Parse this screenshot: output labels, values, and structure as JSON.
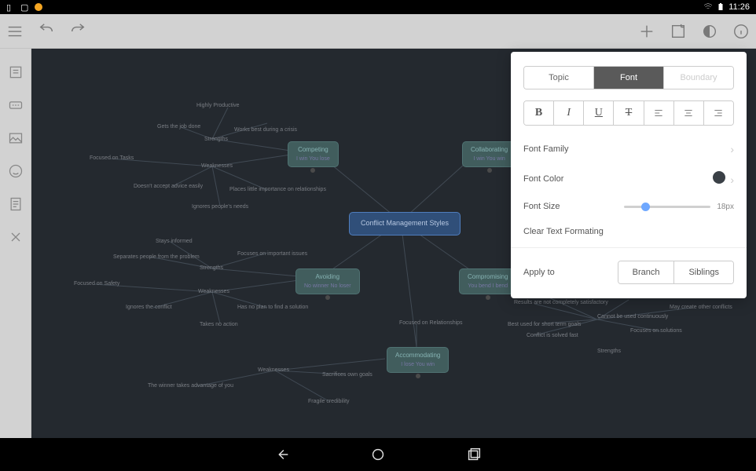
{
  "status": {
    "time": "11:26"
  },
  "toolbar": {
    "menu": "menu",
    "undo": "undo",
    "redo": "redo",
    "add": "add",
    "note": "note",
    "theme": "theme",
    "info": "info"
  },
  "sidebar": {
    "outline": "outline-icon",
    "markers": "markers-icon",
    "image": "image-icon",
    "emoji": "emoji-icon",
    "notes": "notes-icon",
    "collapse": "collapse-icon"
  },
  "mindmap": {
    "center": "Conflict Management Styles",
    "nodes": [
      {
        "id": "competing",
        "title": "Competing",
        "subtitle": "I win You lose"
      },
      {
        "id": "collaborating",
        "title": "Collaborating",
        "subtitle": "I win You win"
      },
      {
        "id": "avoiding",
        "title": "Avoiding",
        "subtitle": "No winner No loser"
      },
      {
        "id": "compromising",
        "title": "Compromising",
        "subtitle": "You bend I bend"
      },
      {
        "id": "accommodating",
        "title": "Accommodating",
        "subtitle": "I lose You win"
      }
    ],
    "labels": {
      "highly_productive": "Highly Productive",
      "gets_job_done": "Gets the job done",
      "works_best_crisis": "Works best during a crisis",
      "strengths1": "Strengths",
      "focused_tasks": "Focused on Tasks",
      "weaknesses1": "Weaknesses",
      "doesnt_accept": "Doesn't accept advice easily",
      "places_little": "Places little importance on relationships",
      "ignores_needs": "Ignores people's needs",
      "stays_informed": "Stays informed",
      "separates_people": "Separates people from the problem",
      "focuses_issues": "Focuses on important issues",
      "strengths2": "Strengths",
      "focused_safety": "Focused on Safety",
      "weaknesses2": "Weaknesses",
      "ignores_conflict": "Ignores the conflict",
      "no_plan": "Has no plan to find a solution",
      "takes_no_action": "Takes no action",
      "focused_relationships": "Focused on Relationships",
      "weaknesses3": "Weaknesses",
      "winner_advantage": "The winner takes advantage of you",
      "fragile_credibility": "Fragile credibility",
      "sacrifices_goals": "Sacrifices own goals",
      "results_not_satisfactory": "Results are not completely satisfactory",
      "best_short_term": "Best used for short term goals",
      "conflict_solved_fast": "Conflict is solved fast",
      "strengths3": "Strengths",
      "focuses_solutions": "Focuses on solutions",
      "cannot_continuous": "Cannot be used continuously",
      "may_create_conflicts": "May create other conflicts"
    }
  },
  "panel": {
    "tabs": {
      "topic": "Topic",
      "font": "Font",
      "boundary": "Boundary"
    },
    "format": {
      "bold": "B",
      "italic": "I",
      "underline": "U",
      "strike": "T"
    },
    "font_family_label": "Font Family",
    "font_color_label": "Font Color",
    "font_color_value": "#3a4046",
    "font_size_label": "Font Size",
    "font_size_value": "18px",
    "clear_label": "Clear Text Formating",
    "apply_to_label": "Apply to",
    "apply_branch": "Branch",
    "apply_siblings": "Siblings"
  }
}
